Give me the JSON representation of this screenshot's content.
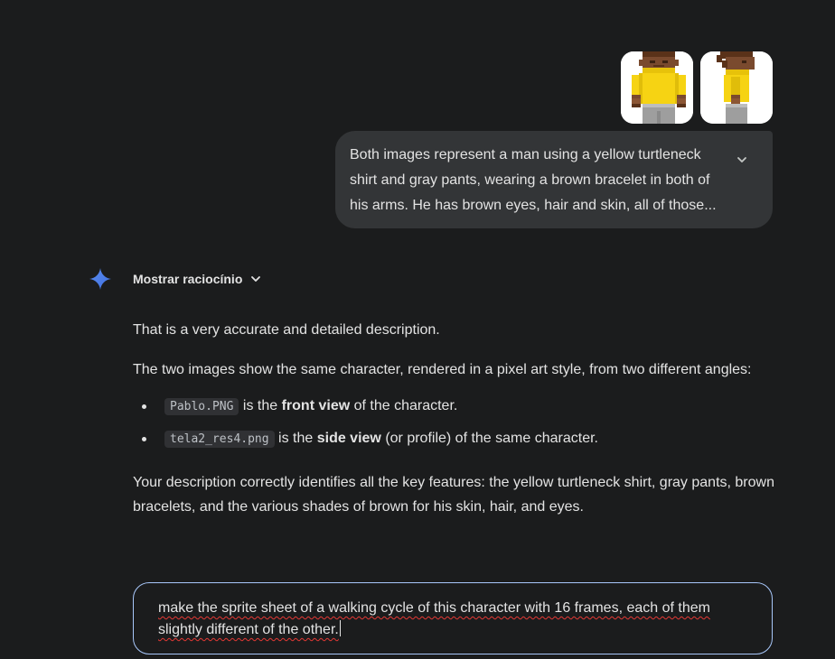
{
  "attachments": [
    {
      "name": "Pablo.PNG",
      "view": "front"
    },
    {
      "name": "tela2_res4.png",
      "view": "side"
    }
  ],
  "user_message": {
    "text": "Both images represent a man using a yellow turtleneck shirt and gray pants, wearing a brown bracelet in both of his arms. He has brown eyes, hair and skin, all of those..."
  },
  "reasoning": {
    "label": "Mostrar raciocínio"
  },
  "response": {
    "p1": "That is a very accurate and detailed description.",
    "p2": "The two images show the same character, rendered in a pixel art style, from two different angles:",
    "bullets": [
      {
        "code": "Pablo.PNG",
        "pre": " is the ",
        "bold": "front view",
        "post": " of the character."
      },
      {
        "code": "tela2_res4.png",
        "pre": " is the ",
        "bold": "side view",
        "post": " (or profile) of the same character."
      }
    ],
    "p3": "Your description correctly identifies all the key features: the yellow turtleneck shirt, gray pants, brown bracelets, and the various shades of brown for his skin, hair, and eyes."
  },
  "input": {
    "value": "make the sprite sheet of a walking cycle of this character with 16 frames, each of them slightly different of the other."
  },
  "colors": {
    "background": "#1b1c1d",
    "bubble": "#333537",
    "input_border": "#a8c7fa",
    "spark_blue": "#4285f4",
    "shirt_yellow": "#f6d313",
    "skin_brown": "#7a4a2e",
    "pants_gray": "#9e9e9e"
  },
  "icons": [
    "gemini-spark-icon",
    "chevron-down-icon",
    "expand-chevron-icon"
  ]
}
